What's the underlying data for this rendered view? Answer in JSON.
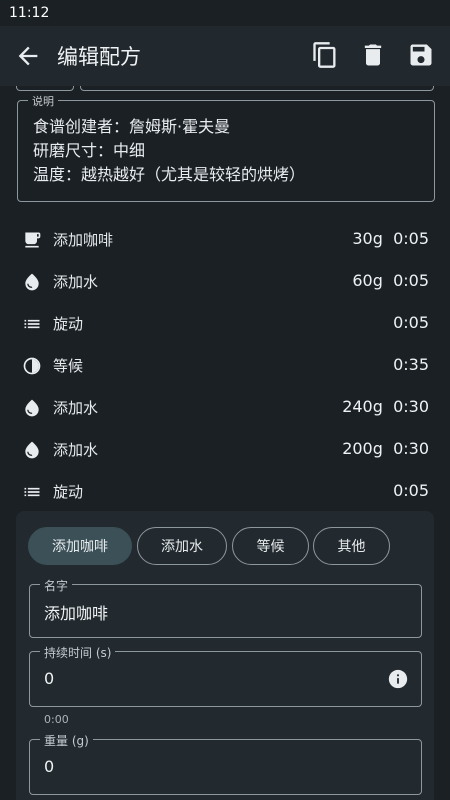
{
  "status": {
    "time": "11:12"
  },
  "appbar": {
    "title": "编辑配方"
  },
  "description": {
    "legend": "说明",
    "lines": [
      "食谱创建者：詹姆斯·霍夫曼",
      "研磨尺寸：中细",
      "温度：越热越好（尤其是较轻的烘烤）"
    ]
  },
  "steps": [
    {
      "icon": "coffee-cup-icon",
      "name": "添加咖啡",
      "weight": "30g",
      "time": "0:05"
    },
    {
      "icon": "water-drop-icon",
      "name": "添加水",
      "weight": "60g",
      "time": "0:05"
    },
    {
      "icon": "list-icon",
      "name": "旋动",
      "weight": "",
      "time": "0:05"
    },
    {
      "icon": "timer-icon",
      "name": "等候",
      "weight": "",
      "time": "0:35"
    },
    {
      "icon": "water-drop-icon",
      "name": "添加水",
      "weight": "240g",
      "time": "0:30"
    },
    {
      "icon": "water-drop-icon",
      "name": "添加水",
      "weight": "200g",
      "time": "0:30"
    },
    {
      "icon": "list-icon",
      "name": "旋动",
      "weight": "",
      "time": "0:05"
    }
  ],
  "editor": {
    "types": [
      "添加咖啡",
      "添加水",
      "等候",
      "其他"
    ],
    "selected_type": "添加咖啡",
    "name_field": {
      "legend": "名字",
      "value": "添加咖啡"
    },
    "duration_field": {
      "legend": "持续时间 (s)",
      "value": "0",
      "helper": "0:00"
    },
    "weight_field": {
      "legend": "重量 (g)",
      "value": "0"
    }
  }
}
